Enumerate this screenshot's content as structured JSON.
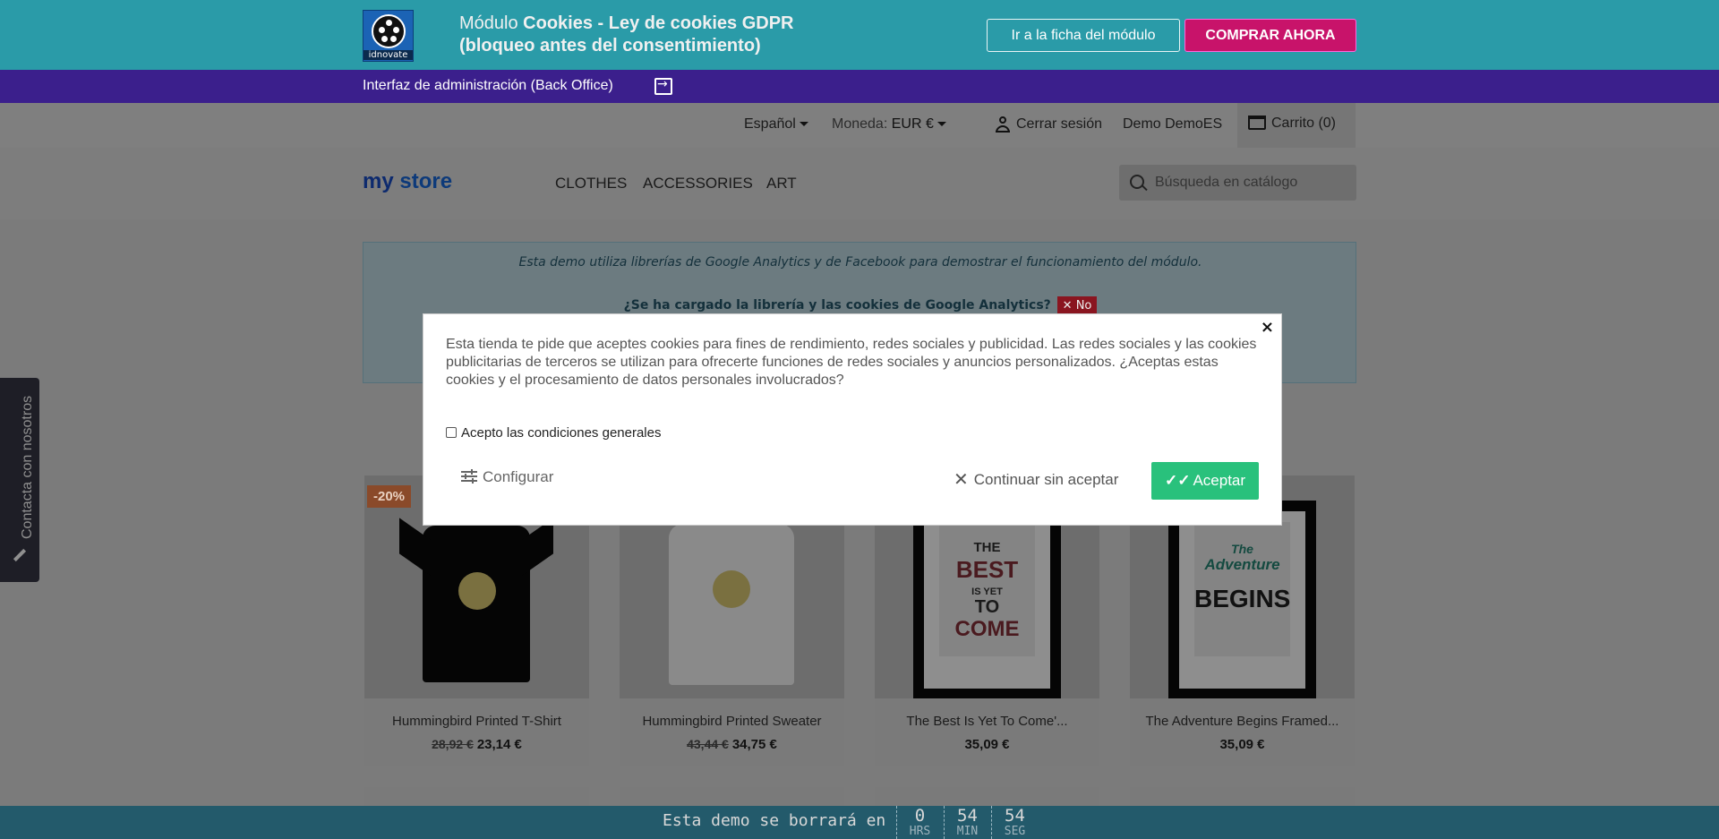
{
  "promo": {
    "logo_text": "idnovate",
    "title_prefix": "Módulo ",
    "title_bold": "Cookies - Ley de cookies GDPR (bloqueo antes del consentimiento)",
    "module_button": "Ir a la ficha del módulo",
    "buy_button": "COMPRAR AHORA"
  },
  "admin_bar": {
    "label": "Interfaz de administración (Back Office)"
  },
  "header": {
    "language": "Español",
    "currency_label": "Moneda:",
    "currency_value": "EUR €",
    "logout": "Cerrar sesión",
    "user": "Demo DemoES",
    "cart": "Carrito (0)"
  },
  "nav": {
    "logo_a": "my",
    "logo_b": "store",
    "items": [
      "CLOTHES",
      "ACCESSORIES",
      "ART"
    ],
    "search_placeholder": "Búsqueda en catálogo"
  },
  "info": {
    "line1": "Esta demo utiliza librerías de Google Analytics y de Facebook para demostrar el funcionamiento del módulo.",
    "question": "¿Se ha cargado la librería y las cookies de Google Analytics?",
    "answer": "No"
  },
  "products": [
    {
      "name": "Hummingbird Printed T-Shirt",
      "old_price": "28,92 €",
      "price": "23,14 €",
      "badge": "-20%"
    },
    {
      "name": "Hummingbird Printed Sweater",
      "old_price": "43,44 €",
      "price": "34,75 €"
    },
    {
      "name": "The Best Is Yet To Come'...",
      "price": "35,09 €",
      "poster": [
        "THE",
        "BEST",
        "IS YET",
        "TO",
        "COME"
      ]
    },
    {
      "name": "The Adventure Begins Framed...",
      "price": "35,09 €",
      "poster": [
        "The",
        "Adventure",
        "BEGINS"
      ]
    }
  ],
  "side_tab": {
    "label": "Contacta con nosotros"
  },
  "modal": {
    "close": "×",
    "text": "Esta tienda te pide que aceptes cookies para fines de rendimiento, redes sociales y publicidad. Las redes sociales y las cookies publicitarias de terceros se utilizan para ofrecerte funciones de redes sociales y anuncios personalizados. ¿Aceptas estas cookies y el procesamiento de datos personales involucrados?",
    "checkbox_label": "Acepto las condiciones generales",
    "configure": "Configurar",
    "continue": "Continuar sin aceptar",
    "accept": "Aceptar"
  },
  "countdown": {
    "label": "Esta demo se borrará en",
    "hours": "0",
    "hours_unit": "HRS",
    "minutes": "54",
    "minutes_unit": "MIN",
    "seconds": "54",
    "seconds_unit": "SEG"
  },
  "colors": {
    "promo_bg": "#2a9ba8",
    "admin_bg": "#3b1f8c",
    "buy_button": "#c8136a",
    "accept_button": "#29c17c",
    "countdown_bg": "#235a6b"
  }
}
